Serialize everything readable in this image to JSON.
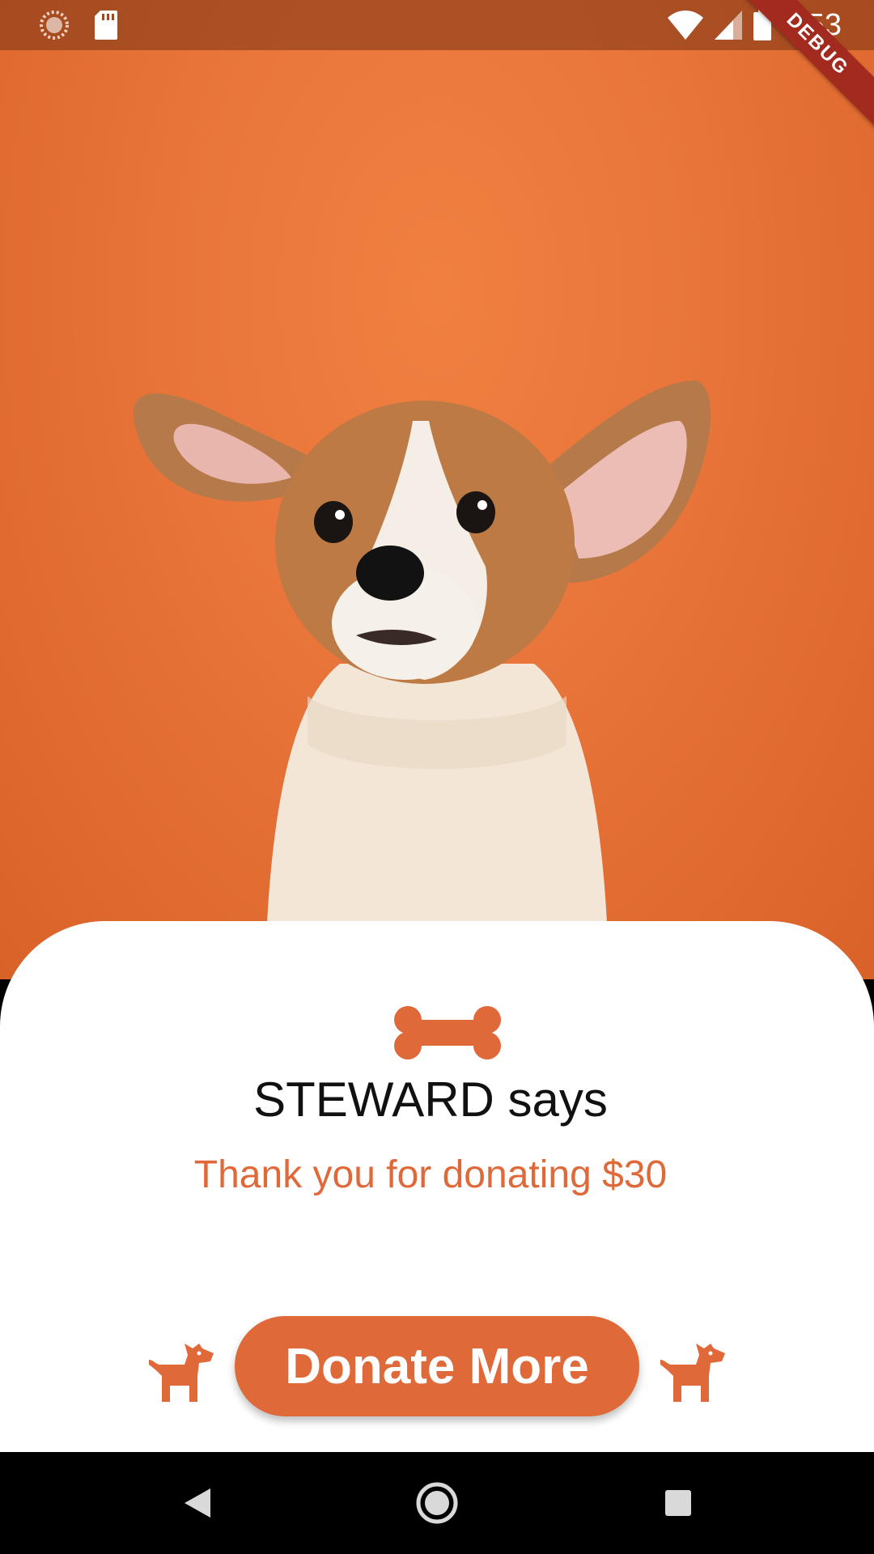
{
  "status_bar": {
    "time": "3:53",
    "icons": [
      "sync-icon",
      "sd-card-icon",
      "wifi-icon",
      "cell-signal-icon",
      "battery-icon"
    ]
  },
  "debug_banner": "DEBUG",
  "card": {
    "icon": "bone-icon",
    "title": "STEWARD says",
    "message": "Thank you for donating $30",
    "button_label": "Donate More",
    "side_icons": [
      "dog-icon",
      "dog-icon"
    ]
  },
  "nav_bar": {
    "buttons": [
      "back-icon",
      "home-icon",
      "recents-icon"
    ]
  },
  "colors": {
    "accent": "#e0693a",
    "background_orange": "#e8743a",
    "card": "#ffffff",
    "nav": "#000000",
    "debug_ribbon": "#a32a1e"
  }
}
